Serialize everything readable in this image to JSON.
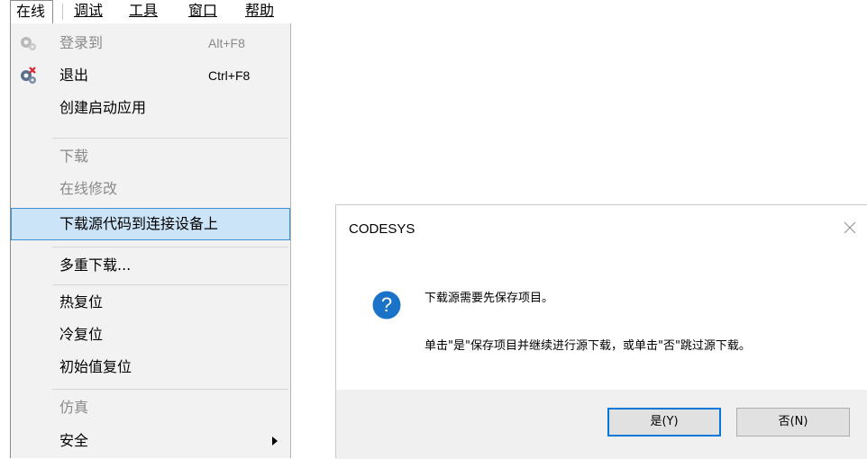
{
  "menubar": {
    "items": [
      "在线",
      "调试",
      "工具",
      "窗口",
      "帮助"
    ]
  },
  "menu": {
    "items": [
      {
        "label": "登录到",
        "shortcut": "Alt+F8",
        "disabled": true,
        "icon": "login-gear-icon"
      },
      {
        "label": "退出",
        "shortcut": "Ctrl+F8",
        "disabled": false,
        "icon": "logout-gear-icon"
      },
      {
        "label": "创建启动应用",
        "disabled": false
      },
      {
        "label": "下载",
        "disabled": true
      },
      {
        "label": "在线修改",
        "disabled": true
      },
      {
        "label": "下载源代码到连接设备上",
        "disabled": false,
        "highlighted": true
      },
      {
        "label": "多重下载...",
        "disabled": false
      },
      {
        "label": "热复位",
        "disabled": false
      },
      {
        "label": "冷复位",
        "disabled": false
      },
      {
        "label": "初始值复位",
        "disabled": false
      },
      {
        "label": "仿真",
        "disabled": true
      },
      {
        "label": "安全",
        "disabled": false,
        "submenu": true
      }
    ]
  },
  "dialog": {
    "title": "CODESYS",
    "icon": "question-icon",
    "message_line1": "下载源需要先保存项目。",
    "message_line2": "单击\"是\"保存项目并继续进行源下载，或单击\"否\"跳过源下载。",
    "yes_button": "是(Y)",
    "no_button": "否(N)"
  },
  "colors": {
    "highlight_bg": "#cce4f7",
    "highlight_border": "#3d8fd6",
    "icon_blue": "#1a73c7",
    "default_button_border": "#0078d7"
  }
}
